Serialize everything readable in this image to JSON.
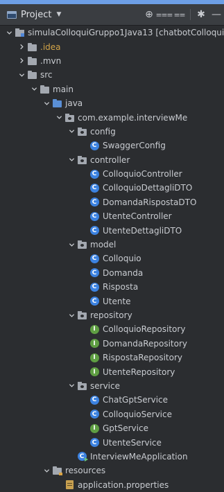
{
  "header": {
    "title": "Project",
    "tools": [
      {
        "name": "locate-icon",
        "glyph": "⊕"
      },
      {
        "name": "expand-all-icon",
        "glyph": "⩶"
      },
      {
        "name": "collapse-all-icon",
        "glyph": "⩵"
      },
      {
        "name": "settings-icon",
        "glyph": "✱"
      },
      {
        "name": "hide-icon",
        "glyph": "—"
      }
    ]
  },
  "tree": [
    {
      "label": "simulaColloquiGruppo1Java13",
      "suffix": " [chatbotColloquio]",
      "icon": "module-folder",
      "level": 0,
      "expanded": true
    },
    {
      "label": ".idea",
      "icon": "folder",
      "level": 1,
      "expanded": false,
      "style": "idea"
    },
    {
      "label": ".mvn",
      "icon": "folder",
      "level": 1,
      "expanded": false
    },
    {
      "label": "src",
      "icon": "folder",
      "level": 1,
      "expanded": true
    },
    {
      "label": "main",
      "icon": "folder",
      "level": 2,
      "expanded": true
    },
    {
      "label": "java",
      "icon": "source-folder",
      "level": 3,
      "expanded": true
    },
    {
      "label": "com.example.interviewMe",
      "icon": "package",
      "level": 4,
      "expanded": true
    },
    {
      "label": "config",
      "icon": "package",
      "level": 5,
      "expanded": true
    },
    {
      "label": "SwaggerConfig",
      "icon": "class",
      "level": 6
    },
    {
      "label": "controller",
      "icon": "package",
      "level": 5,
      "expanded": true
    },
    {
      "label": "ColloquioController",
      "icon": "class",
      "level": 6
    },
    {
      "label": "ColloquioDettagliDTO",
      "icon": "class",
      "level": 6
    },
    {
      "label": "DomandaRispostaDTO",
      "icon": "class",
      "level": 6
    },
    {
      "label": "UtenteController",
      "icon": "class",
      "level": 6
    },
    {
      "label": "UtenteDettagliDTO",
      "icon": "class",
      "level": 6
    },
    {
      "label": "model",
      "icon": "package",
      "level": 5,
      "expanded": true
    },
    {
      "label": "Colloquio",
      "icon": "class",
      "level": 6
    },
    {
      "label": "Domanda",
      "icon": "class",
      "level": 6
    },
    {
      "label": "Risposta",
      "icon": "class",
      "level": 6
    },
    {
      "label": "Utente",
      "icon": "class",
      "level": 6
    },
    {
      "label": "repository",
      "icon": "package",
      "level": 5,
      "expanded": true
    },
    {
      "label": "ColloquioRepository",
      "icon": "interface",
      "level": 6
    },
    {
      "label": "DomandaRepository",
      "icon": "interface",
      "level": 6
    },
    {
      "label": "RispostaRepository",
      "icon": "interface",
      "level": 6
    },
    {
      "label": "UtenteRepository",
      "icon": "interface",
      "level": 6
    },
    {
      "label": "service",
      "icon": "package",
      "level": 5,
      "expanded": true
    },
    {
      "label": "ChatGptService",
      "icon": "class",
      "level": 6
    },
    {
      "label": "ColloquioService",
      "icon": "class",
      "level": 6
    },
    {
      "label": "GptService",
      "icon": "interface",
      "level": 6
    },
    {
      "label": "UtenteService",
      "icon": "class",
      "level": 6
    },
    {
      "label": "InterviewMeApplication",
      "icon": "app-class",
      "level": 5
    },
    {
      "label": "resources",
      "icon": "resources-folder",
      "level": 3,
      "expanded": true
    },
    {
      "label": "application.properties",
      "icon": "properties-file",
      "level": 4
    }
  ]
}
